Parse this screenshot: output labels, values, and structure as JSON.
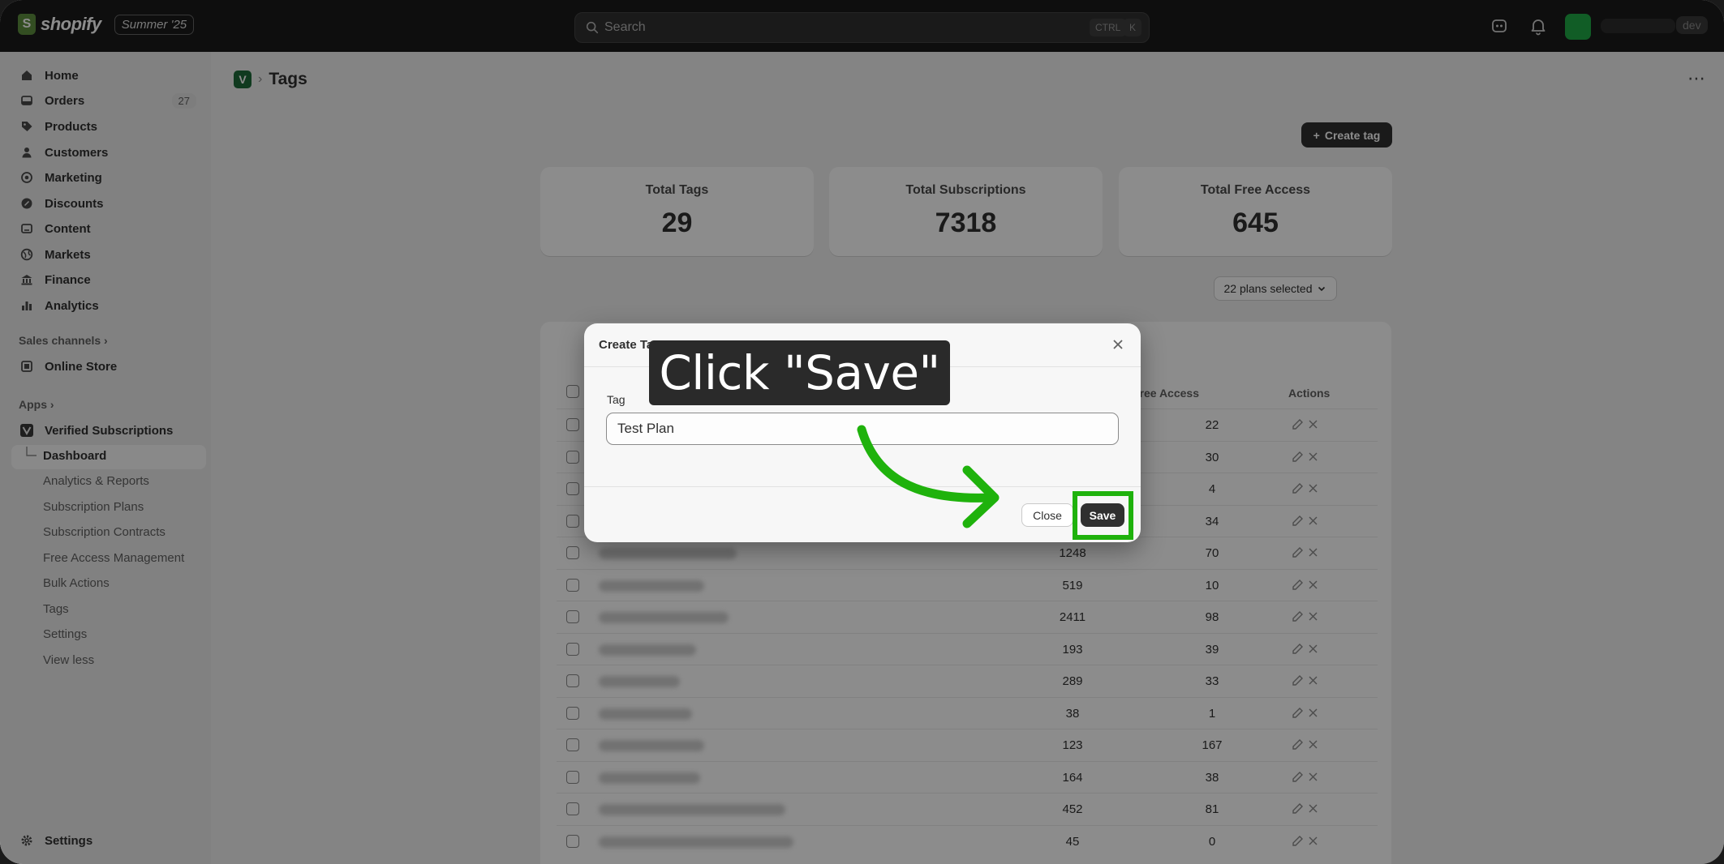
{
  "topbar": {
    "brand": "shopify",
    "edition_badge": "Summer '25",
    "search_placeholder": "Search",
    "shortcut_ctrl": "CTRL",
    "shortcut_k": "K",
    "dev_badge": "dev"
  },
  "sidebar": {
    "main_items": [
      {
        "label": "Home",
        "icon": "home-icon"
      },
      {
        "label": "Orders",
        "icon": "orders-icon",
        "count": "27"
      },
      {
        "label": "Products",
        "icon": "tag-icon"
      },
      {
        "label": "Customers",
        "icon": "person-icon"
      },
      {
        "label": "Marketing",
        "icon": "target-icon"
      },
      {
        "label": "Discounts",
        "icon": "discount-icon"
      },
      {
        "label": "Content",
        "icon": "content-icon"
      },
      {
        "label": "Markets",
        "icon": "globe-icon"
      },
      {
        "label": "Finance",
        "icon": "bank-icon"
      },
      {
        "label": "Analytics",
        "icon": "bar-chart-icon"
      }
    ],
    "sales_channels_label": "Sales channels",
    "online_store": "Online Store",
    "apps_label": "Apps",
    "app_name": "Verified Subscriptions",
    "app_sub_items": [
      "Dashboard",
      "Analytics & Reports",
      "Subscription Plans",
      "Subscription Contracts",
      "Free Access Management",
      "Bulk Actions",
      "Tags",
      "Settings",
      "View less"
    ],
    "settings": "Settings"
  },
  "page": {
    "title": "Tags",
    "create_button": "Create tag",
    "stats": [
      {
        "label": "Total Tags",
        "value": "29"
      },
      {
        "label": "Total Subscriptions",
        "value": "7318"
      },
      {
        "label": "Total Free Access",
        "value": "645"
      }
    ],
    "plans_filter": "22 plans selected",
    "table_headers": {
      "free_access": "Free Access",
      "actions": "Actions"
    },
    "rows": [
      {
        "subs": "",
        "free": "22"
      },
      {
        "subs": "",
        "free": "30"
      },
      {
        "subs": "",
        "free": "4"
      },
      {
        "subs": "",
        "free": "34"
      },
      {
        "subs": "1248",
        "free": "70"
      },
      {
        "subs": "519",
        "free": "10"
      },
      {
        "subs": "2411",
        "free": "98"
      },
      {
        "subs": "193",
        "free": "39"
      },
      {
        "subs": "289",
        "free": "33"
      },
      {
        "subs": "38",
        "free": "1"
      },
      {
        "subs": "123",
        "free": "167"
      },
      {
        "subs": "164",
        "free": "38"
      },
      {
        "subs": "452",
        "free": "81"
      },
      {
        "subs": "45",
        "free": "0"
      }
    ]
  },
  "modal": {
    "title": "Create Tag",
    "field_label": "Tag",
    "field_value": "Test Plan",
    "close_button": "Close",
    "save_button": "Save"
  },
  "annotation": {
    "callout_text": "Click \"Save\"",
    "highlight_color": "#1fb20c"
  },
  "colors": {
    "topbar": "#1a1a1a",
    "primary_button": "#303030",
    "avatar": "#1fa945"
  }
}
